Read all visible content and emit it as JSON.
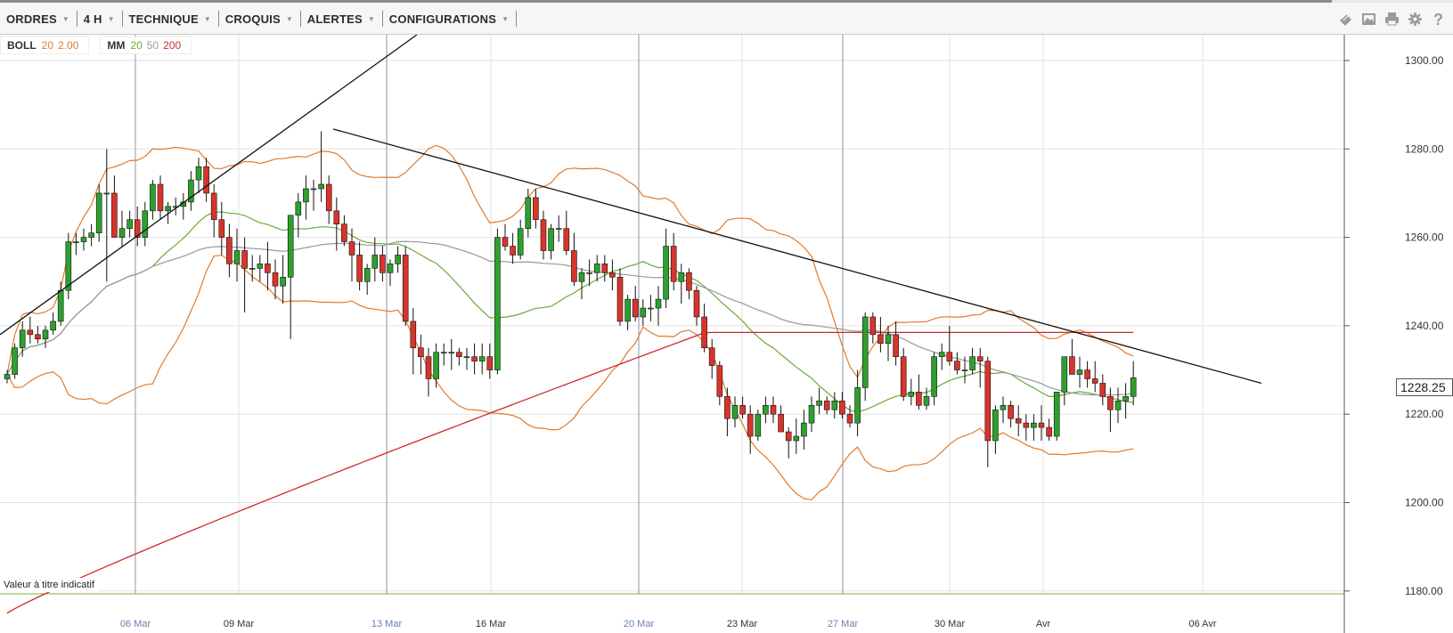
{
  "toolbar": {
    "menu": [
      {
        "label": "ORDRES"
      },
      {
        "label": "4 H"
      },
      {
        "label": "TECHNIQUE"
      },
      {
        "label": "CROQUIS"
      },
      {
        "label": "ALERTES"
      },
      {
        "label": "CONFIGURATIONS"
      }
    ],
    "icons": [
      "layers-icon",
      "image-icon",
      "print-icon",
      "gear-icon",
      "help-icon"
    ]
  },
  "legend": {
    "boll": {
      "name": "BOLL",
      "period": "20",
      "stddev": "2.00"
    },
    "mm": {
      "name": "MM",
      "p1": "20",
      "p2": "50",
      "p3": "200"
    }
  },
  "colors": {
    "bull": "#2da02d",
    "bear": "#d9342b",
    "bollinger": "#e07b2e",
    "ma20": "#6aaa3a",
    "ma50": "#999999",
    "ma200": "#cc2a2a",
    "trendline": "#111111",
    "grid": "#e2e2e2",
    "boll_label": "#e07b2e",
    "ma20_label": "#6aaa3a",
    "ma50_label": "#999999",
    "ma200_label": "#cc2a2a"
  },
  "price_axis": {
    "ticks": [
      "1300.00",
      "1280.00",
      "1260.00",
      "1240.00",
      "1220.00",
      "1200.00",
      "1180.00"
    ]
  },
  "current_price": "1228.25",
  "cut_label": "1180.53",
  "disclaimer": "Valeur à titre indicatif",
  "chart_data": {
    "type": "candlestick",
    "timeframe": "4 H",
    "ylim": [
      1180,
      1300
    ],
    "y_ticks": [
      1180,
      1200,
      1220,
      1240,
      1260,
      1280,
      1300
    ],
    "x_labels": [
      {
        "label": "06 Mar",
        "highlight": true
      },
      {
        "label": "09 Mar",
        "highlight": false
      },
      {
        "label": "13 Mar",
        "highlight": true
      },
      {
        "label": "16 Mar",
        "highlight": false
      },
      {
        "label": "20 Mar",
        "highlight": true
      },
      {
        "label": "23 Mar",
        "highlight": false
      },
      {
        "label": "27 Mar",
        "highlight": true
      },
      {
        "label": "30 Mar",
        "highlight": false
      },
      {
        "label": "Avr",
        "highlight": false
      },
      {
        "label": "06 Avr",
        "highlight": false
      }
    ],
    "candles": [
      [
        1228,
        1230,
        1227,
        1229
      ],
      [
        1229,
        1236,
        1228,
        1235
      ],
      [
        1235,
        1241,
        1233,
        1239
      ],
      [
        1239,
        1242,
        1236,
        1238
      ],
      [
        1238,
        1240,
        1236,
        1237
      ],
      [
        1237,
        1240,
        1235,
        1239
      ],
      [
        1239,
        1243,
        1238,
        1241
      ],
      [
        1241,
        1250,
        1240,
        1248
      ],
      [
        1248,
        1261,
        1246,
        1259
      ],
      [
        1259,
        1261,
        1256,
        1259
      ],
      [
        1259,
        1262,
        1257,
        1260
      ],
      [
        1260,
        1263,
        1258,
        1261
      ],
      [
        1261,
        1272,
        1259,
        1270
      ],
      [
        1270,
        1280,
        1250,
        1270
      ],
      [
        1270,
        1274,
        1260,
        1260
      ],
      [
        1260,
        1266,
        1258,
        1262
      ],
      [
        1262,
        1266,
        1260,
        1264
      ],
      [
        1264,
        1267,
        1258,
        1260
      ],
      [
        1260,
        1268,
        1258,
        1266
      ],
      [
        1266,
        1273,
        1264,
        1272
      ],
      [
        1272,
        1274,
        1264,
        1266
      ],
      [
        1266,
        1268,
        1263,
        1267
      ],
      [
        1267,
        1269,
        1265,
        1267
      ],
      [
        1267,
        1270,
        1264,
        1268
      ],
      [
        1268,
        1275,
        1266,
        1273
      ],
      [
        1273,
        1278,
        1270,
        1276
      ],
      [
        1276,
        1278,
        1268,
        1270
      ],
      [
        1270,
        1272,
        1260,
        1264
      ],
      [
        1264,
        1268,
        1256,
        1260
      ],
      [
        1260,
        1263,
        1251,
        1254
      ],
      [
        1254,
        1262,
        1250,
        1257
      ],
      [
        1257,
        1260,
        1243,
        1253
      ],
      [
        1253,
        1256,
        1250,
        1253
      ],
      [
        1253,
        1256,
        1250,
        1254
      ],
      [
        1254,
        1259,
        1248,
        1252
      ],
      [
        1252,
        1255,
        1246,
        1249
      ],
      [
        1249,
        1256,
        1245,
        1251
      ],
      [
        1251,
        1261,
        1237,
        1265
      ],
      [
        1265,
        1270,
        1260,
        1268
      ],
      [
        1268,
        1274,
        1264,
        1271
      ],
      [
        1271,
        1273,
        1266,
        1271
      ],
      [
        1271,
        1284,
        1268,
        1272
      ],
      [
        1272,
        1274,
        1263,
        1266
      ],
      [
        1266,
        1269,
        1257,
        1263
      ],
      [
        1263,
        1265,
        1258,
        1259
      ],
      [
        1259,
        1262,
        1250,
        1256
      ],
      [
        1256,
        1259,
        1248,
        1250
      ],
      [
        1250,
        1254,
        1247,
        1253
      ],
      [
        1253,
        1260,
        1250,
        1256
      ],
      [
        1256,
        1258,
        1250,
        1252
      ],
      [
        1252,
        1255,
        1249,
        1254
      ],
      [
        1254,
        1258,
        1252,
        1256
      ],
      [
        1256,
        1258,
        1240,
        1241
      ],
      [
        1241,
        1244,
        1229,
        1235
      ],
      [
        1235,
        1238,
        1229,
        1233
      ],
      [
        1233,
        1235,
        1224,
        1228
      ],
      [
        1228,
        1236,
        1226,
        1234
      ],
      [
        1234,
        1236,
        1231,
        1234
      ],
      [
        1234,
        1237,
        1230,
        1234
      ],
      [
        1234,
        1235,
        1231,
        1233
      ],
      [
        1233,
        1235,
        1230,
        1233
      ],
      [
        1233,
        1236,
        1229,
        1232
      ],
      [
        1232,
        1236,
        1229,
        1233
      ],
      [
        1233,
        1236,
        1228,
        1230
      ],
      [
        1230,
        1262,
        1229,
        1260
      ],
      [
        1260,
        1263,
        1257,
        1258
      ],
      [
        1258,
        1261,
        1254,
        1256
      ],
      [
        1256,
        1264,
        1255,
        1262
      ],
      [
        1262,
        1271,
        1260,
        1269
      ],
      [
        1269,
        1271,
        1262,
        1264
      ],
      [
        1264,
        1266,
        1255,
        1257
      ],
      [
        1257,
        1263,
        1255,
        1262
      ],
      [
        1262,
        1265,
        1259,
        1262
      ],
      [
        1262,
        1266,
        1256,
        1257
      ],
      [
        1257,
        1261,
        1249,
        1250
      ],
      [
        1250,
        1253,
        1246,
        1252
      ],
      [
        1252,
        1255,
        1249,
        1252
      ],
      [
        1252,
        1256,
        1250,
        1254
      ],
      [
        1254,
        1256,
        1250,
        1252
      ],
      [
        1252,
        1255,
        1248,
        1251
      ],
      [
        1251,
        1253,
        1240,
        1241
      ],
      [
        1241,
        1247,
        1239,
        1246
      ],
      [
        1246,
        1249,
        1241,
        1242
      ],
      [
        1242,
        1246,
        1240,
        1244
      ],
      [
        1244,
        1247,
        1241,
        1244
      ],
      [
        1244,
        1249,
        1240,
        1246
      ],
      [
        1246,
        1262,
        1244,
        1258
      ],
      [
        1258,
        1261,
        1248,
        1250
      ],
      [
        1250,
        1254,
        1245,
        1252
      ],
      [
        1252,
        1253,
        1246,
        1248
      ],
      [
        1248,
        1249,
        1240,
        1242
      ],
      [
        1242,
        1245,
        1234,
        1235
      ],
      [
        1235,
        1237,
        1228,
        1231
      ],
      [
        1231,
        1232,
        1222,
        1224
      ],
      [
        1224,
        1226,
        1215,
        1219
      ],
      [
        1219,
        1224,
        1217,
        1222
      ],
      [
        1222,
        1224,
        1219,
        1220
      ],
      [
        1220,
        1222,
        1211,
        1215
      ],
      [
        1215,
        1221,
        1214,
        1220
      ],
      [
        1220,
        1224,
        1218,
        1222
      ],
      [
        1222,
        1224,
        1218,
        1220
      ],
      [
        1220,
        1222,
        1217,
        1216
      ],
      [
        1216,
        1217,
        1210,
        1214
      ],
      [
        1214,
        1219,
        1211,
        1215
      ],
      [
        1215,
        1221,
        1212,
        1218
      ],
      [
        1218,
        1224,
        1216,
        1222
      ],
      [
        1222,
        1226,
        1220,
        1223
      ],
      [
        1223,
        1224,
        1220,
        1221
      ],
      [
        1221,
        1225,
        1219,
        1223
      ],
      [
        1223,
        1225,
        1219,
        1220
      ],
      [
        1220,
        1222,
        1217,
        1218
      ],
      [
        1218,
        1230,
        1215,
        1226
      ],
      [
        1226,
        1243,
        1223,
        1242
      ],
      [
        1242,
        1243,
        1236,
        1238
      ],
      [
        1238,
        1242,
        1234,
        1236
      ],
      [
        1236,
        1240,
        1232,
        1238
      ],
      [
        1238,
        1241,
        1231,
        1233
      ],
      [
        1233,
        1235,
        1223,
        1224
      ],
      [
        1224,
        1228,
        1222,
        1225
      ],
      [
        1225,
        1229,
        1221,
        1222
      ],
      [
        1222,
        1226,
        1221,
        1224
      ],
      [
        1224,
        1234,
        1222,
        1233
      ],
      [
        1233,
        1236,
        1230,
        1234
      ],
      [
        1234,
        1240,
        1231,
        1232
      ],
      [
        1232,
        1234,
        1229,
        1230
      ],
      [
        1230,
        1233,
        1227,
        1230
      ],
      [
        1230,
        1235,
        1229,
        1233
      ],
      [
        1233,
        1235,
        1226,
        1232
      ],
      [
        1232,
        1233,
        1208,
        1214
      ],
      [
        1214,
        1222,
        1211,
        1221
      ],
      [
        1221,
        1224,
        1218,
        1222
      ],
      [
        1222,
        1223,
        1217,
        1219
      ],
      [
        1219,
        1222,
        1215,
        1218
      ],
      [
        1218,
        1220,
        1214,
        1217
      ],
      [
        1217,
        1220,
        1214,
        1218
      ],
      [
        1218,
        1222,
        1214,
        1217
      ],
      [
        1217,
        1219,
        1214,
        1215
      ],
      [
        1215,
        1222,
        1214,
        1225
      ],
      [
        1225,
        1232,
        1222,
        1233
      ],
      [
        1233,
        1237,
        1229,
        1229
      ],
      [
        1229,
        1233,
        1226,
        1230
      ],
      [
        1230,
        1232,
        1226,
        1228
      ],
      [
        1228,
        1232,
        1225,
        1227
      ],
      [
        1227,
        1229,
        1222,
        1224
      ],
      [
        1224,
        1226,
        1216,
        1221
      ],
      [
        1221,
        1226,
        1218,
        1223
      ],
      [
        1223,
        1227,
        1219,
        1224
      ],
      [
        1224,
        1232,
        1222,
        1228.25
      ]
    ],
    "indicators": [
      "BOLL 20 2.00",
      "MM 20",
      "MM 50",
      "MM 200"
    ]
  }
}
